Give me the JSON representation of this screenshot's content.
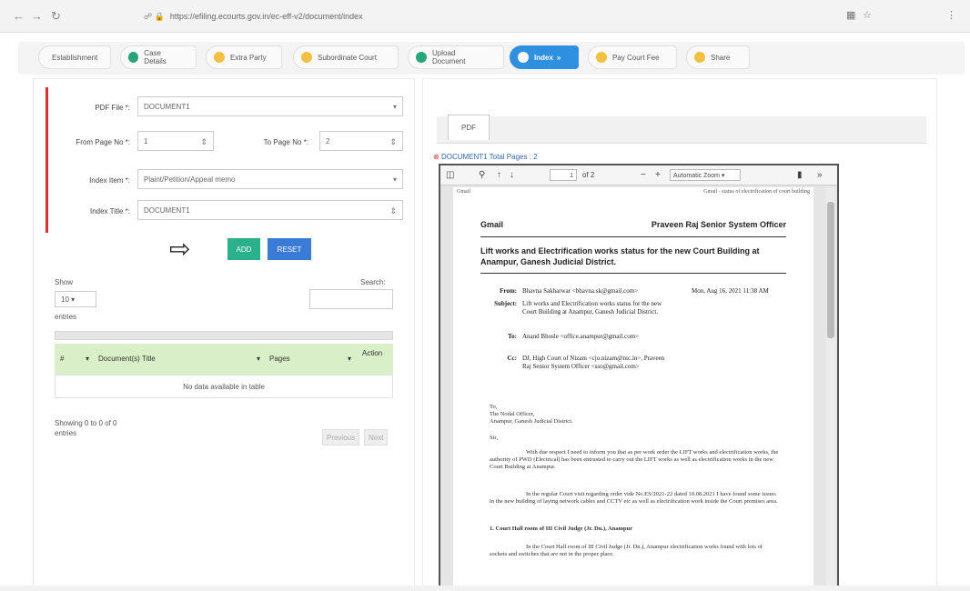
{
  "browser": {
    "url": "https://efiling.ecourts.gov.in/ec-eff-v2/document/index",
    "icons": [
      "back-icon",
      "forward-icon",
      "reload-icon",
      "info-icon",
      "lock-icon",
      "reader-icon",
      "favorite-icon",
      "menu-icon"
    ]
  },
  "stepper": {
    "steps": [
      {
        "label": "Establishment",
        "state": "done"
      },
      {
        "label": "Case Details",
        "state": "done"
      },
      {
        "label": "Extra Party",
        "state": "pending"
      },
      {
        "label": "Subordinate Court",
        "state": "pending"
      },
      {
        "label": "Upload Document",
        "state": "done"
      },
      {
        "label": "Index",
        "state": "active"
      },
      {
        "label": "Pay Court Fee",
        "state": "pending"
      },
      {
        "label": "Share",
        "state": "pending"
      }
    ]
  },
  "form": {
    "pdf_file_label": "PDF File *:",
    "pdf_file_value": "DOCUMENT1",
    "from_page_label": "From Page No *:",
    "from_page_value": "1",
    "to_page_label": "To Page No *:",
    "to_page_value": "2",
    "index_item_label": "Index Item *:",
    "index_item_value": "Plaint/Petition/Appeal memo",
    "index_title_label": "Index Title *:",
    "index_title_value": "DOCUMENT1",
    "add_button": "ADD",
    "reset_button": "RESET"
  },
  "table": {
    "show_label": "Show",
    "show_value": "10",
    "entries_label": "entries",
    "search_label": "Search:",
    "columns": [
      "#",
      "Document(s) Title",
      "Pages",
      "Action"
    ],
    "empty_message": "No data available in table",
    "info": "Showing 0 to 0 of 0 entries",
    "prev_button": "Previous",
    "next_button": "Next"
  },
  "viewer": {
    "tab_label": "PDF",
    "doc_info": "DOCUMENT1 Total Pages : 2",
    "page_input": "1",
    "page_total": "of 2",
    "zoom": "Automatic Zoom",
    "page_header_left": "Gmail",
    "page_header_right": "Gmail - status of electrification of court building",
    "email_head": "Gmail",
    "sender_head": "Praveen Raj Senior System Officer",
    "subject_title": "Lift works and Electrification works status for the new Court Building at Anampur, Ganesh Judicial District.",
    "from_label": "From:",
    "from_value": "Bhavna Sakharwar <bhavna.sk@gmail.com>",
    "date_value": "Mon, Aug 16, 2021 11:38 AM",
    "subject_label": "Subject:",
    "subject_value": "Lift works and Electrification works status for the new Court Building at Anampur, Ganesh Judicial District.",
    "to_label": "To:",
    "to_value": "Anand Bhosle <office.anampur@gmail.com>",
    "cc_label": "Cc:",
    "cc_value": "DJ, High Court of Nizam <cjo.nizam@nic.in>, Praveen Raj Senior System Officer <sso@gmail.com>",
    "to_block": "To,",
    "to_block_2": "The Nodal Officer,",
    "to_block_3": "Anampur, Ganesh Judicial District.",
    "sir": "Sir,",
    "para1": "With due respect I need to inform you that as per work order the LIFT works and electrification works, the authority of PWD (Electrical) has been entrusted to carry out the LIFT works as well as electrification works in the new Court Building at Anampur.",
    "para2": "In the regular Court visit regarding order vide No.ES/2021-22 dated 10.08.2021 I have found some issues in the new building of laying network cables and CCTV etc as well as electrification work inside the Court premises area.",
    "section1": "1. Court Hall room of III Civil Judge (Jr. Dn.), Anampur",
    "para3": "In the Court Hall room of III Civil Judge (Jr. Dn.), Anampur electrification works found with lots of sockets and switches that are not in the proper place."
  }
}
